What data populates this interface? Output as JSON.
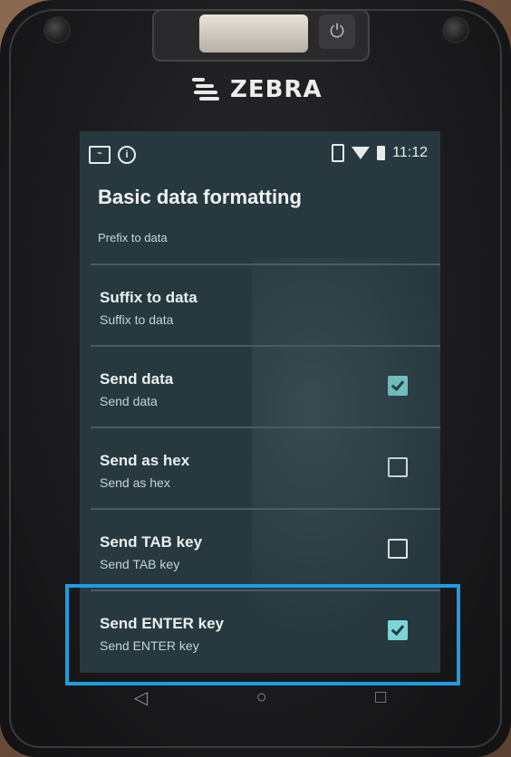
{
  "device": {
    "brand": "ZEBRA"
  },
  "status_bar": {
    "time": "11:12",
    "left_icons": [
      "gallery-icon",
      "info-icon"
    ],
    "right_icons": [
      "vibrate-icon",
      "wifi-icon",
      "battery-icon"
    ]
  },
  "page": {
    "title": "Basic data formatting",
    "section_item": "Prefix to data"
  },
  "settings": [
    {
      "title": "Suffix to data",
      "summary": "Suffix to data",
      "has_checkbox": false
    },
    {
      "title": "Send data",
      "summary": "Send data",
      "has_checkbox": true,
      "checked": true
    },
    {
      "title": "Send as hex",
      "summary": "Send as hex",
      "has_checkbox": true,
      "checked": false
    },
    {
      "title": "Send TAB key",
      "summary": "Send TAB key",
      "has_checkbox": true,
      "checked": false
    },
    {
      "title": "Send ENTER key",
      "summary": "Send ENTER key",
      "has_checkbox": true,
      "checked": true
    }
  ],
  "navbar": {
    "back": "◁",
    "home": "○",
    "recents": "□"
  },
  "accent_color": "#7ad6d6",
  "highlight_color": "#1e9ce0",
  "power_symbol": "⏻"
}
